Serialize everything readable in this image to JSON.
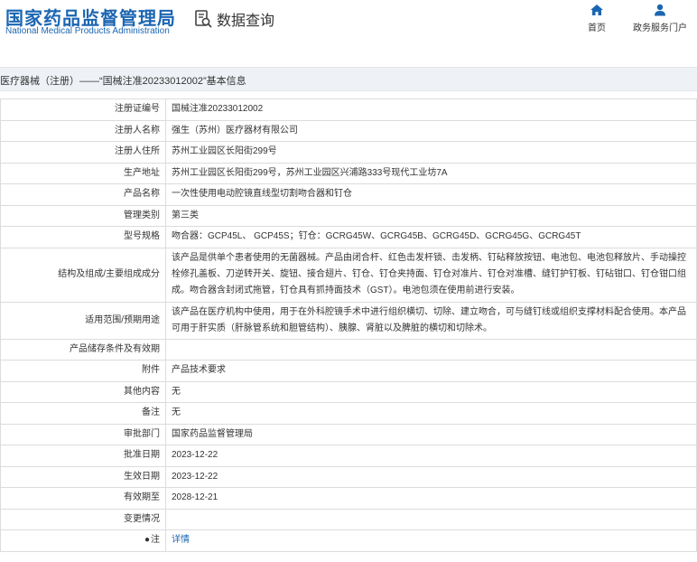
{
  "header": {
    "logo_cn": "国家药品监督管理局",
    "logo_en": "National Medical Products Administration",
    "query_label": "数据查询",
    "nav": [
      {
        "label": "首页"
      },
      {
        "label": "政务服务门户"
      }
    ]
  },
  "title": "医疗器械（注册）——“国械注准20233012002”基本信息",
  "rows": [
    {
      "label": "注册证编号",
      "value": "国械注准20233012002"
    },
    {
      "label": "注册人名称",
      "value": "强生（苏州）医疗器材有限公司"
    },
    {
      "label": "注册人住所",
      "value": "苏州工业园区长阳街299号"
    },
    {
      "label": "生产地址",
      "value": "苏州工业园区长阳街299号，苏州工业园区兴浦路333号现代工业坊7A"
    },
    {
      "label": "产品名称",
      "value": "一次性使用电动腔镜直线型切割吻合器和钉仓"
    },
    {
      "label": "管理类别",
      "value": "第三类"
    },
    {
      "label": "型号规格",
      "value": "吻合器：GCP45L、 GCP45S；钉仓：GCRG45W、GCRG45B、GCRG45D、GCRG45G、GCRG45T"
    },
    {
      "label": "结构及组成/主要组成成分",
      "value": "该产品是供单个患者使用的无菌器械。产品由闭合杆、红色击发杆锁、击发柄、钉砧释放按钮、电池包、电池包释放片、手动操控栓修孔盖板、刀逆转开关、旋钮、接合翅片、钉仓、钉仓夹持面、钉仓对准片、钉仓对准槽、缝钉护钉板、钉砧钳口、钉仓钳口组成。吻合器含封闭式拖管，钉仓具有抓持面技术（GST）。电池包须在使用前进行安装。"
    },
    {
      "label": "适用范围/预期用途",
      "value": "该产品在医疗机构中使用，用于在外科腔镜手术中进行组织横切、切除、建立吻合，可与缝钉线或组织支撑材料配合使用。本产品可用于肝实质（肝脉管系统和胆管结构）、胰腺、肾脏以及脾脏的横切和切除术。"
    },
    {
      "label": "产品储存条件及有效期",
      "value": ""
    },
    {
      "label": "附件",
      "value": "产品技术要求"
    },
    {
      "label": "其他内容",
      "value": "无"
    },
    {
      "label": "备注",
      "value": "无"
    },
    {
      "label": "审批部门",
      "value": "国家药品监督管理局"
    },
    {
      "label": "批准日期",
      "value": "2023-12-22"
    },
    {
      "label": "生效日期",
      "value": "2023-12-22"
    },
    {
      "label": "有效期至",
      "value": "2028-12-21"
    },
    {
      "label": "变更情况",
      "value": ""
    },
    {
      "label": "注",
      "value": "详情"
    }
  ],
  "colors": {
    "brand": "#1b66b2",
    "title_bg": "#eef2f6",
    "border": "#dcdcdc"
  },
  "icons": {
    "query": "document-search-icon",
    "home": "home-icon",
    "service": "user-icon",
    "note": "pin-icon"
  }
}
